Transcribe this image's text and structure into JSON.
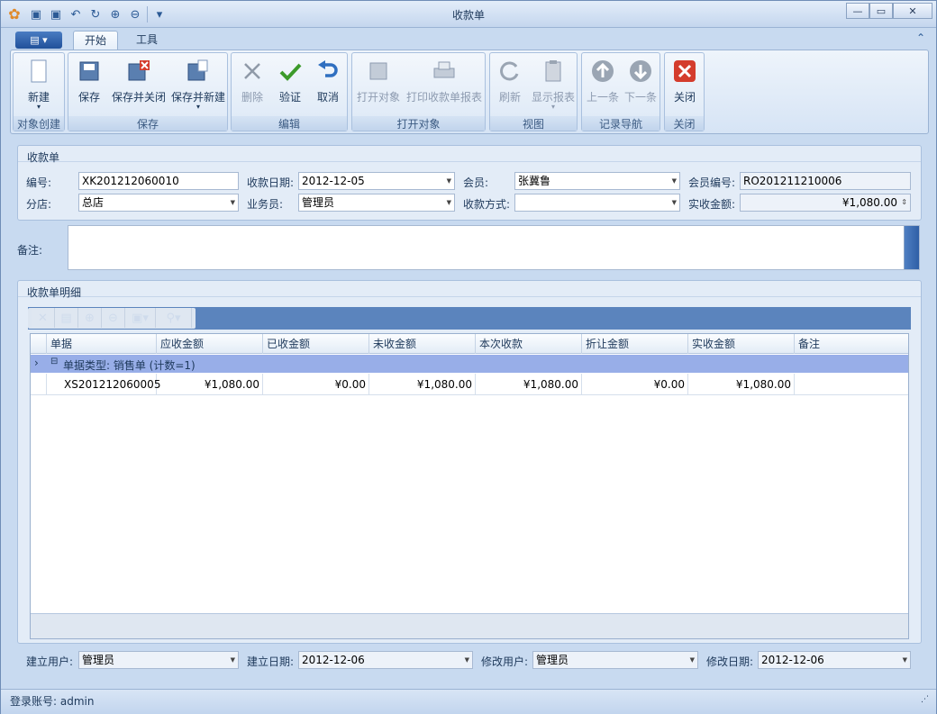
{
  "window": {
    "title": "收款单"
  },
  "tabs": {
    "start": "开始",
    "tools": "工具"
  },
  "ribbon": {
    "groups": {
      "create": "对象创建",
      "save": "保存",
      "edit": "编辑",
      "open": "打开对象",
      "view": "视图",
      "nav": "记录导航",
      "close": "关闭"
    },
    "buttons": {
      "new": "新建",
      "save": "保存",
      "save_close": "保存并关闭",
      "save_new": "保存并新建",
      "delete": "删除",
      "validate": "验证",
      "cancel": "取消",
      "open_obj": "打开对象",
      "print_report": "打印收款单报表",
      "refresh": "刷新",
      "show_report": "显示报表",
      "prev": "上一条",
      "next": "下一条",
      "close": "关闭"
    }
  },
  "form": {
    "panel_title": "收款单",
    "labels": {
      "code": "编号:",
      "date": "收款日期:",
      "member": "会员:",
      "member_code": "会员编号:",
      "branch": "分店:",
      "salesman": "业务员:",
      "pay_method": "收款方式:",
      "actual": "实收金额:",
      "memo": "备注:"
    },
    "values": {
      "code": "XK201212060010",
      "date": "2012-12-05",
      "member": "张冀鲁",
      "member_code": "RO201211210006",
      "branch": "总店",
      "salesman": "管理员",
      "pay_method": "",
      "actual": "¥1,080.00"
    }
  },
  "detail": {
    "panel_title": "收款单明细",
    "columns": [
      "单据",
      "应收金额",
      "已收金额",
      "未收金额",
      "本次收款",
      "折让金额",
      "实收金额",
      "备注"
    ],
    "group_row": "单据类型: 销售单 (计数=1)",
    "rows": [
      [
        "XS201212060005",
        "¥1,080.00",
        "¥0.00",
        "¥1,080.00",
        "¥1,080.00",
        "¥0.00",
        "¥1,080.00",
        ""
      ]
    ]
  },
  "footer": {
    "labels": {
      "create_user": "建立用户:",
      "create_date": "建立日期:",
      "modify_user": "修改用户:",
      "modify_date": "修改日期:"
    },
    "values": {
      "create_user": "管理员",
      "create_date": "2012-12-06",
      "modify_user": "管理员",
      "modify_date": "2012-12-06"
    }
  },
  "status": {
    "text": "登录账号: admin"
  }
}
